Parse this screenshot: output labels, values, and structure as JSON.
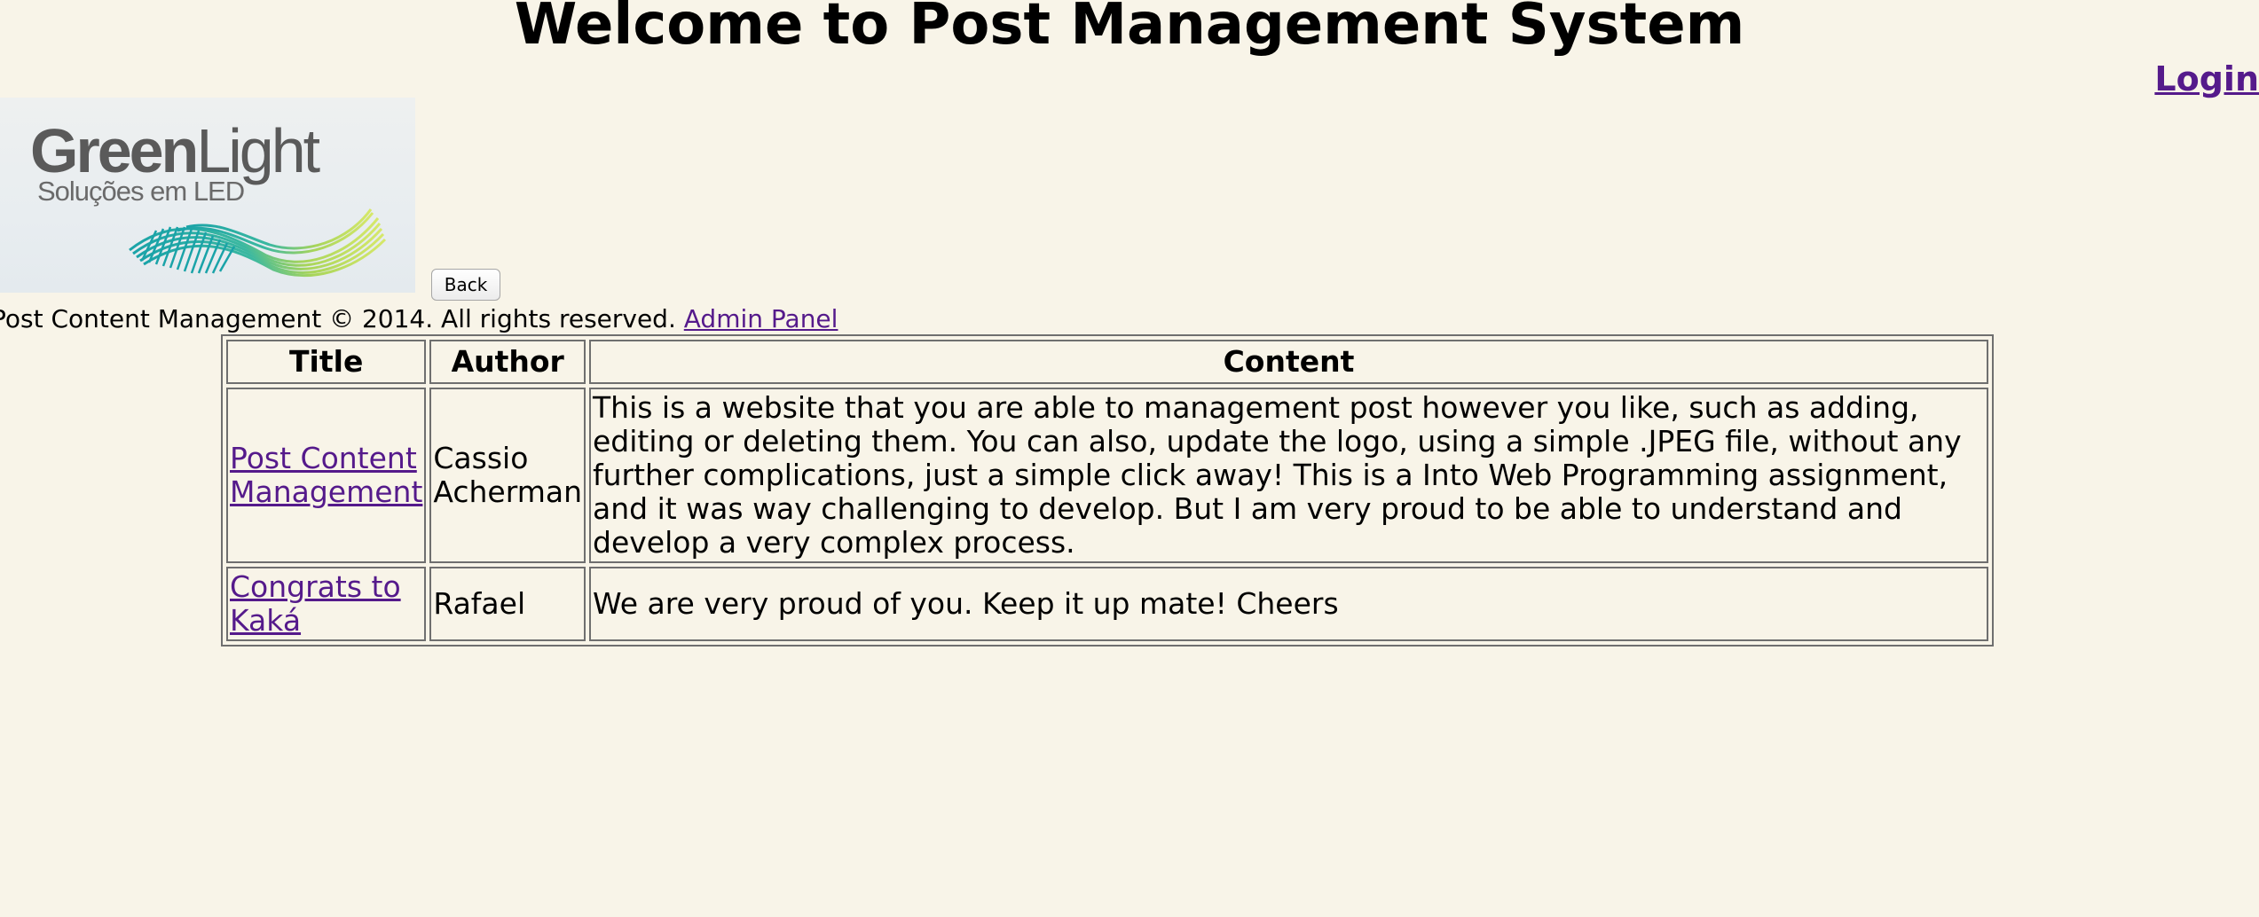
{
  "header": {
    "title": "Welcome to Post Management System",
    "login_label": "Login"
  },
  "logo": {
    "brand_green": "Green",
    "brand_light": "Light",
    "tagline": "Soluções em LED",
    "colors": {
      "text": "#5a5a5a",
      "wave_teal": "#1aa3a8",
      "wave_lime": "#b9d84a"
    }
  },
  "back_button": {
    "label": "Back"
  },
  "footer": {
    "text": "Post Content Management © 2014. All rights reserved.",
    "admin_link": "Admin Panel"
  },
  "table": {
    "headers": {
      "title": "Title",
      "author": "Author",
      "content": "Content"
    },
    "rows": [
      {
        "title": "Post Content Management",
        "author": "Cassio Acherman",
        "content": "This is a website that you are able to management post however you like, such as adding, editing or deleting them. You can also, update the logo, using a simple .JPEG file, without any further complications, just a simple click away! This is a Into Web Programming assignment, and it was way challenging to develop. But I am very proud to be able to understand and develop a very complex process."
      },
      {
        "title": "Congrats to Kaká",
        "author": "Rafael",
        "content": "We are very proud of you. Keep it up mate! Cheers"
      }
    ]
  },
  "colors": {
    "background": "#f8f4e8",
    "link": "#551a8b",
    "table_border": "#6f6f6f"
  }
}
